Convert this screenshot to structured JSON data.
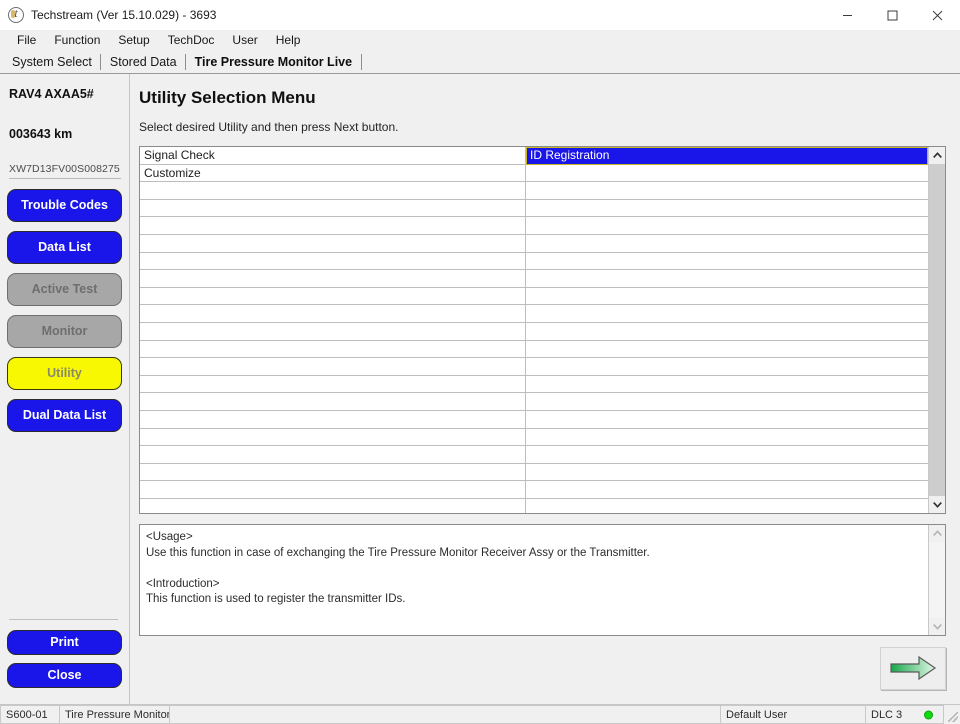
{
  "window": {
    "title": "Techstream (Ver 15.10.029) - 3693",
    "app_icon": "techstream-logo-icon",
    "controls": {
      "minimize": "minimize-icon",
      "maximize": "maximize-icon",
      "close": "close-icon"
    }
  },
  "menubar": {
    "items": [
      "File",
      "Function",
      "Setup",
      "TechDoc",
      "User",
      "Help"
    ]
  },
  "tabs": [
    {
      "label": "System Select",
      "active": false
    },
    {
      "label": "Stored Data",
      "active": false
    },
    {
      "label": "Tire Pressure Monitor Live",
      "active": true
    }
  ],
  "sidebar": {
    "vehicle_model": "RAV4 AXAA5#",
    "odometer": "003643 km",
    "vin": "XW7D13FV00S008275",
    "buttons": [
      {
        "label": "Trouble Codes",
        "state": "enabled"
      },
      {
        "label": "Data List",
        "state": "enabled"
      },
      {
        "label": "Active Test",
        "state": "disabled"
      },
      {
        "label": "Monitor",
        "state": "disabled"
      },
      {
        "label": "Utility",
        "state": "selected"
      },
      {
        "label": "Dual Data List",
        "state": "enabled"
      }
    ],
    "footer_buttons": [
      {
        "label": "Print",
        "state": "enabled"
      },
      {
        "label": "Close",
        "state": "enabled"
      }
    ]
  },
  "main": {
    "title": "Utility Selection Menu",
    "instruction": "Select desired Utility and then press Next button.",
    "list": {
      "column_left": [
        "Signal Check",
        "Customize"
      ],
      "column_right": [
        "ID Registration"
      ],
      "selected_item": "ID Registration",
      "total_rows": 20,
      "scrollbar": {
        "up_arrow": "chevron-up-icon",
        "down_arrow": "chevron-down-icon"
      }
    },
    "usage_panel": {
      "text": "<Usage>\nUse this function in case of exchanging the Tire Pressure Monitor Receiver Assy or the Transmitter.\n\n<Introduction>\nThis function is used to register the transmitter IDs.",
      "scrollbar": {
        "up_arrow": "chevron-up-icon",
        "down_arrow": "chevron-down-icon"
      }
    },
    "next_button": {
      "icon": "arrow-right-icon",
      "label": "Next"
    }
  },
  "statusbar": {
    "code": "S600-01",
    "system": "Tire Pressure Monitor",
    "blank": "",
    "user": "Default User",
    "connection": "DLC 3",
    "led_color": "#12d912"
  },
  "colors": {
    "accent_blue": "#1a15e8",
    "utility_yellow": "#f8f802",
    "disabled_gray": "#a7a7a7",
    "selection_border": "#c9b824",
    "arrow_green_dark": "#16a84a",
    "arrow_green_light": "#e2f6e8"
  }
}
